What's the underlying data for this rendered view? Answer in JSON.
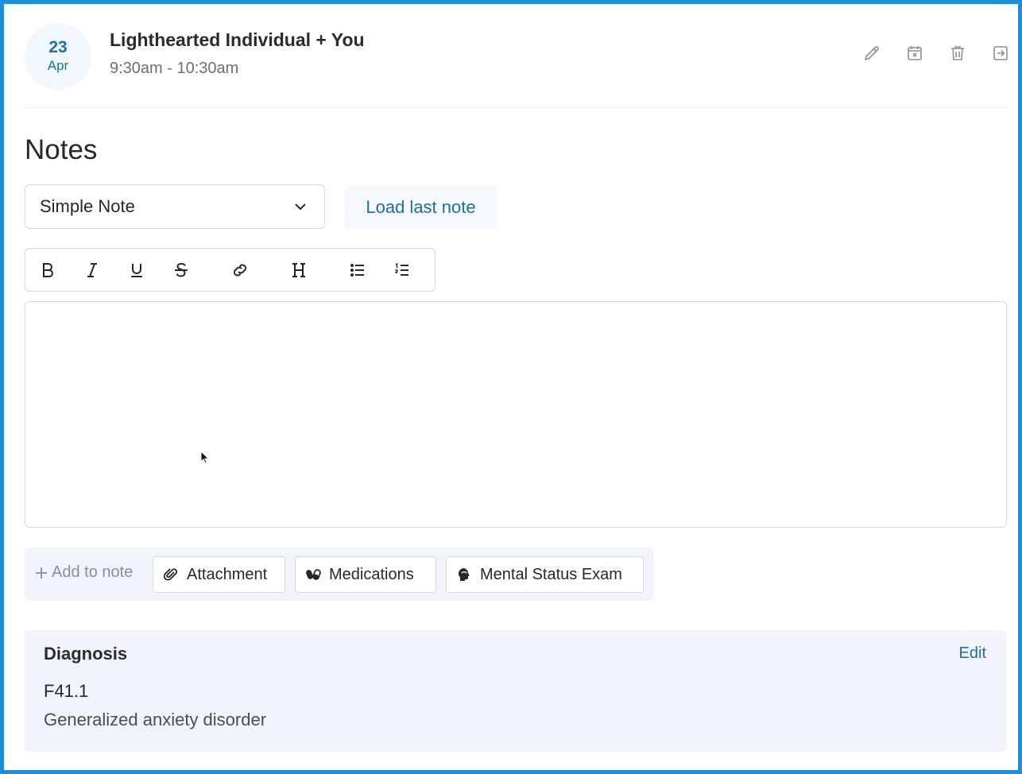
{
  "event": {
    "date_day": "23",
    "date_month": "Apr",
    "title": "Lighthearted Individual + You",
    "time": "9:30am - 10:30am"
  },
  "header_actions": [
    {
      "icon": "pencil-icon"
    },
    {
      "icon": "calendar-x-icon"
    },
    {
      "icon": "trash-icon"
    },
    {
      "icon": "exit-icon"
    }
  ],
  "notes": {
    "title": "Notes",
    "template_select": {
      "value": "Simple Note"
    },
    "load_last_label": "Load last note",
    "toolbar": [
      "bold",
      "italic",
      "underline",
      "strikethrough",
      "link",
      "heading",
      "bullet-list",
      "numbered-list"
    ],
    "editor_value": ""
  },
  "add_to_note": {
    "label": "Add to note",
    "chips": [
      {
        "label": "Attachment",
        "icon": "paperclip-icon"
      },
      {
        "label": "Medications",
        "icon": "pills-icon"
      },
      {
        "label": "Mental Status Exam",
        "icon": "brain-icon"
      }
    ]
  },
  "diagnosis": {
    "title": "Diagnosis",
    "edit_label": "Edit",
    "code": "F41.1",
    "description": "Generalized anxiety disorder"
  },
  "colors": {
    "accent": "#1b6fa6",
    "frame": "#1a8fdd",
    "panel_bg": "#f1f4fa"
  }
}
